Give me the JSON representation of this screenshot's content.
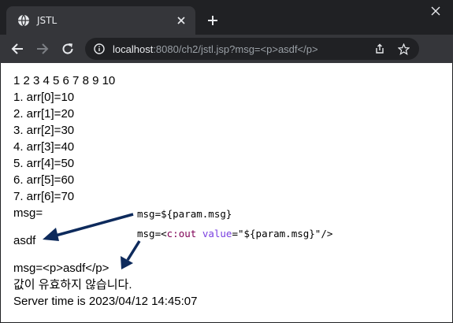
{
  "browser": {
    "tab_title": "JSTL",
    "url_host": "localhost",
    "url_rest": ":8080/ch2/jstl.jsp?msg=<p>asdf</p>",
    "colors": {
      "frame": "#202124",
      "toolbar": "#35363a",
      "text": "#e8eaed",
      "muted": "#9aa0a6"
    },
    "icons": [
      "globe-icon",
      "close-icon",
      "plus-icon",
      "back-arrow-icon",
      "forward-arrow-icon",
      "reload-icon",
      "info-icon",
      "share-icon",
      "star-icon"
    ]
  },
  "page": {
    "numbers": "1 2 3 4 5 6 7 8 9 10",
    "arr_items": [
      "1. arr[0]=10",
      "2. arr[1]=20",
      "3. arr[2]=30",
      "4. arr[3]=40",
      "5. arr[4]=50",
      "6. arr[5]=60",
      "7. arr[6]=70"
    ],
    "msg_label": "msg=",
    "asdf": "asdf",
    "msg_escaped": "msg=<p>asdf</p>",
    "invalid_value": "값이 유효하지 않습니다.",
    "server_time": "Server time is 2023/04/12 14:45:07"
  },
  "annotations": {
    "note1": "msg=${param.msg}",
    "note2_prefix": "msg=<",
    "note2_tag": "c:out",
    "note2_attr": "value",
    "note2_value": "=\"${param.msg}\"/>",
    "arrow_color": "#0d2a5c"
  }
}
